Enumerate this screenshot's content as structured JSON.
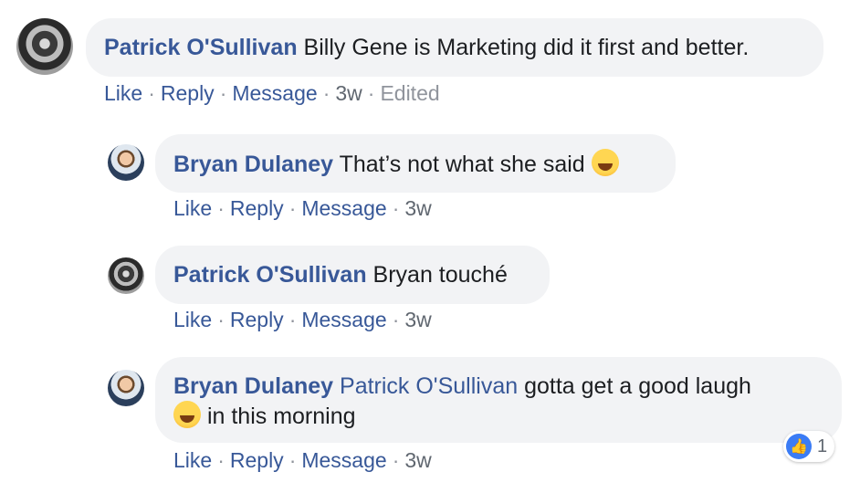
{
  "comments": [
    {
      "author": "Patrick O'Sullivan",
      "text": "Billy Gene is Marketing did it first and better.",
      "actions": {
        "like": "Like",
        "reply": "Reply",
        "message": "Message",
        "time": "3w",
        "edited": "Edited"
      }
    },
    {
      "author": "Bryan Dulaney",
      "text": "That’s not what she said",
      "emoji": "rolling-on-floor-laughing-emoji",
      "actions": {
        "like": "Like",
        "reply": "Reply",
        "message": "Message",
        "time": "3w"
      }
    },
    {
      "author": "Patrick O'Sullivan",
      "text": "Bryan touché",
      "actions": {
        "like": "Like",
        "reply": "Reply",
        "message": "Message",
        "time": "3w"
      }
    },
    {
      "author": "Bryan Dulaney",
      "mention": "Patrick O'Sullivan",
      "text_line1": "gotta get a good laugh",
      "text_line2": "in this morning",
      "emoji": "grinning-squinting-emoji",
      "actions": {
        "like": "Like",
        "reply": "Reply",
        "message": "Message",
        "time": "3w"
      },
      "reaction": {
        "icon": "thumbs-up-icon",
        "count": "1"
      }
    }
  ],
  "separator": "·"
}
